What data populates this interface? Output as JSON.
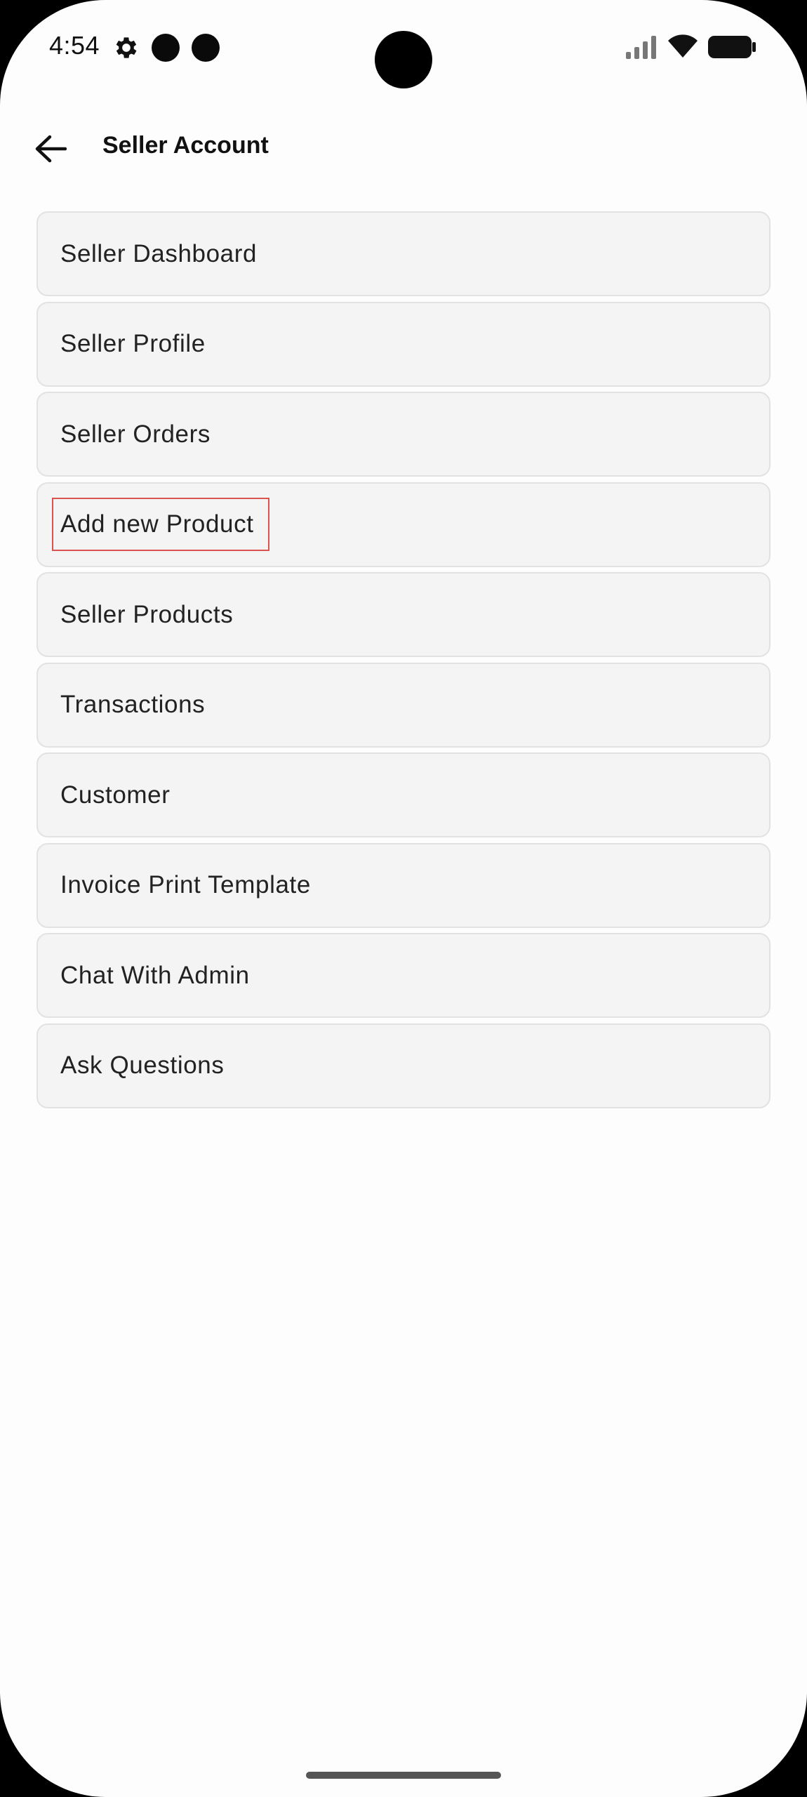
{
  "status_bar": {
    "time": "4:54",
    "icons": [
      "gear-icon",
      "notification-dot-icon",
      "notification-dot-icon",
      "signal-icon",
      "wifi-icon",
      "battery-icon"
    ]
  },
  "app_bar": {
    "back_icon": "arrow-left-icon",
    "title": "Seller Account"
  },
  "menu": {
    "items": [
      {
        "label": "Seller Dashboard"
      },
      {
        "label": "Seller Profile"
      },
      {
        "label": "Seller Orders"
      },
      {
        "label": "Add new Product",
        "highlighted": true
      },
      {
        "label": "Seller Products"
      },
      {
        "label": "Transactions"
      },
      {
        "label": "Customer"
      },
      {
        "label": "Invoice Print Template"
      },
      {
        "label": "Chat With Admin"
      },
      {
        "label": "Ask Questions"
      }
    ]
  },
  "colors": {
    "background": "#fdfdfd",
    "item_background": "#f4f4f4",
    "item_border": "#e2e2e2",
    "highlight_outline": "#d9534f",
    "text": "#222222"
  }
}
